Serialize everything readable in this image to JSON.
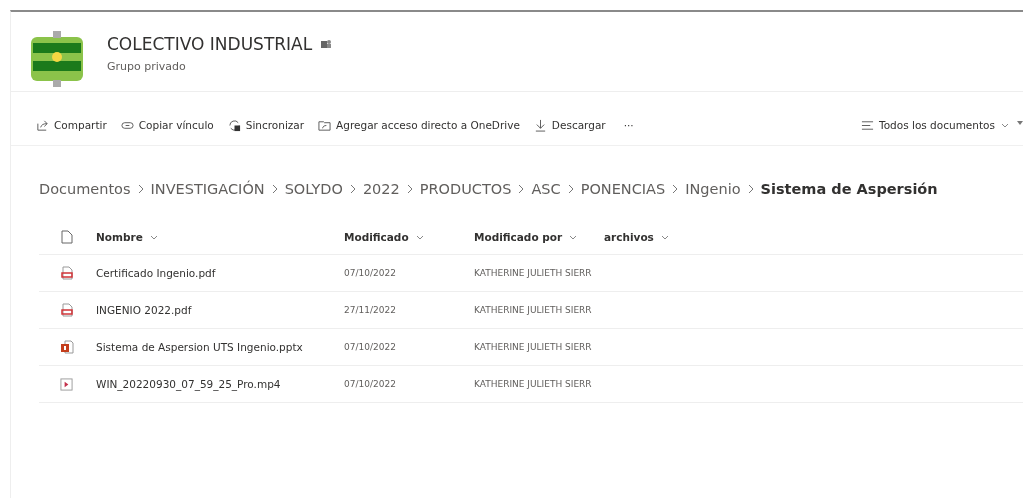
{
  "site": {
    "title": "COLECTIVO INDUSTRIAL",
    "subtitle": "Grupo privado"
  },
  "toolbar": {
    "actions": [
      {
        "label": "Compartir",
        "kind": "share"
      },
      {
        "label": "Copiar vínculo",
        "kind": "link"
      },
      {
        "label": "Sincronizar",
        "kind": "sync"
      },
      {
        "label": "Agregar acceso directo a OneDrive",
        "kind": "shortcut"
      },
      {
        "label": "Descargar",
        "kind": "download"
      }
    ],
    "more": "···",
    "view": "Todos los documentos"
  },
  "breadcrumb": [
    "Documentos",
    "INVESTIGACIÓN",
    "SOLYDO",
    "2022",
    "PRODUCTOS",
    "ASC",
    "PONENCIAS",
    "INgenio",
    "Sistema de Aspersión"
  ],
  "table": {
    "columns": [
      "Nombre",
      "Modificado",
      "Modificado por",
      "archivos"
    ],
    "rows": [
      {
        "kind": "pdf",
        "name": "Certificado Ingenio.pdf",
        "modified": "07/10/2022",
        "modified_by": "KATHERINE JULIETH SIERR"
      },
      {
        "kind": "pdf",
        "name": "INGENIO 2022.pdf",
        "modified": "27/11/2022",
        "modified_by": "KATHERINE JULIETH SIERR"
      },
      {
        "kind": "pptx",
        "name": "Sistema de Aspersion UTS Ingenio.pptx",
        "modified": "07/10/2022",
        "modified_by": "KATHERINE JULIETH SIERR"
      },
      {
        "kind": "video",
        "name": "WIN_20220930_07_59_25_Pro.mp4",
        "modified": "07/10/2022",
        "modified_by": "KATHERINE JULIETH SIERR"
      }
    ]
  }
}
